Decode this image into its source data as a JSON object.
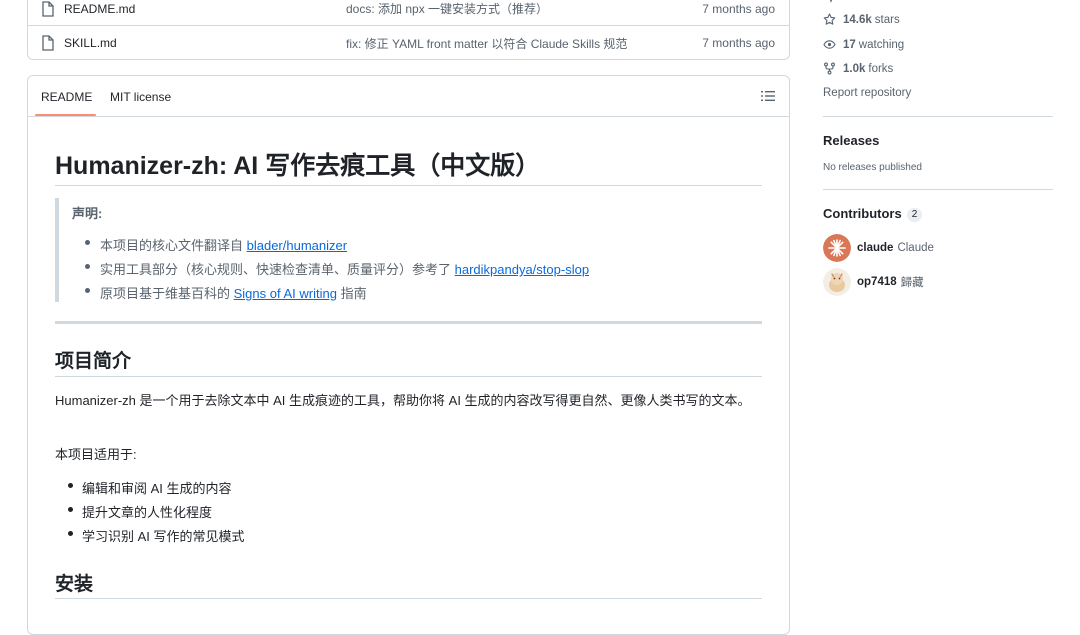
{
  "files": [
    {
      "name": "README.md",
      "message": "docs: 添加 npx 一键安装方式（推荐）",
      "time": "7 months ago"
    },
    {
      "name": "SKILL.md",
      "message": "fix: 修正 YAML front matter 以符合 Claude Skills 规范",
      "time": "7 months ago"
    }
  ],
  "readme": {
    "tabs": [
      "README",
      "MIT license"
    ],
    "title": "Humanizer-zh: AI 写作去痕工具（中文版）",
    "notice": {
      "title": "声明:",
      "items": [
        {
          "pre": "本项目的核心文件翻译自 ",
          "link": "blader/humanizer",
          "post": ""
        },
        {
          "pre": "实用工具部分（核心规则、快速检查清单、质量评分）参考了 ",
          "link": "hardikpandya/stop-slop",
          "post": ""
        },
        {
          "pre": "原项目基于维基百科的 ",
          "link": "Signs of AI writing",
          "post": " 指南"
        }
      ]
    },
    "section1_title": "项目简介",
    "intro": "Humanizer-zh 是一个用于去除文本中 AI 生成痕迹的工具，帮助你将 AI 生成的内容改写得更自然、更像人类书写的文本。",
    "applies_label": "本项目适用于:",
    "applies": [
      "编辑和审阅 AI 生成的内容",
      "提升文章的人性化程度",
      "学习识别 AI 写作的常见模式"
    ],
    "section2_title": "安装"
  },
  "sidebar": {
    "stars": {
      "count": "14.6k",
      "label": "stars"
    },
    "watching": {
      "count": "17",
      "label": "watching"
    },
    "forks": {
      "count": "1.0k",
      "label": "forks"
    },
    "report": "Report repository",
    "releases_title": "Releases",
    "releases_note": "No releases published",
    "contributors_title": "Contributors",
    "contributors_count": "2",
    "contributors": [
      {
        "login": "claude",
        "name": "Claude"
      },
      {
        "login": "op7418",
        "name": "歸藏"
      }
    ]
  },
  "colors": {
    "link": "#0969da",
    "tab_underline": "#fd8c73",
    "claude_avatar": "#d97757"
  }
}
